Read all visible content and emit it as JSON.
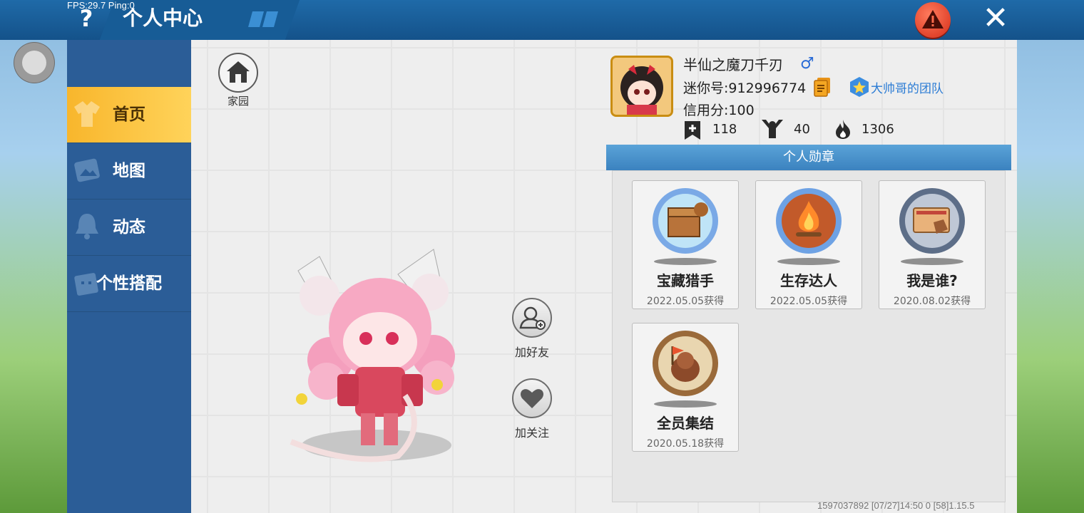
{
  "debug": {
    "fps_ping": "FPS:29.7  Ping:0",
    "footer": "1597037892    [07/27]14:50 0  [58]1.15.5"
  },
  "header": {
    "help_glyph": "?",
    "title": "个人中心",
    "close_glyph": "✕"
  },
  "sidebar": {
    "items": [
      {
        "label": "首页",
        "active": true,
        "icon": "home-shirt-icon"
      },
      {
        "label": "地图",
        "active": false,
        "icon": "map-icon"
      },
      {
        "label": "动态",
        "active": false,
        "icon": "bell-icon"
      },
      {
        "label": "个性搭配",
        "active": false,
        "icon": "outfit-icon"
      }
    ]
  },
  "home": {
    "label": "家园"
  },
  "actions": {
    "add_friend": "加好友",
    "follow": "加关注"
  },
  "profile": {
    "nickname": "半仙之魔刀千刃",
    "gender_symbol": "♂",
    "mini_id": "迷你号:912996774",
    "team": "大帅哥的团队",
    "credit": "信用分:100",
    "stats": [
      {
        "icon": "bookmark-plus-icon",
        "value": "118"
      },
      {
        "icon": "fans-icon",
        "value": "40"
      },
      {
        "icon": "fire-icon",
        "value": "1306"
      }
    ]
  },
  "medals": {
    "title": "个人勋章",
    "items": [
      {
        "name": "宝藏猎手",
        "date": "2022.05.05获得",
        "icon": "treasure-chest-medal-icon"
      },
      {
        "name": "生存达人",
        "date": "2022.05.05获得",
        "icon": "campfire-medal-icon"
      },
      {
        "name": "我是谁?",
        "date": "2020.08.02获得",
        "icon": "id-card-medal-icon"
      },
      {
        "name": "全员集结",
        "date": "2020.05.18获得",
        "icon": "flag-medal-icon"
      }
    ]
  },
  "colors": {
    "topbar": "#1a5f9a",
    "sidebar": "#2b5d97",
    "active_tab": "#f8b62c",
    "medal_header": "#4a93cd",
    "alert": "#e0351e"
  }
}
